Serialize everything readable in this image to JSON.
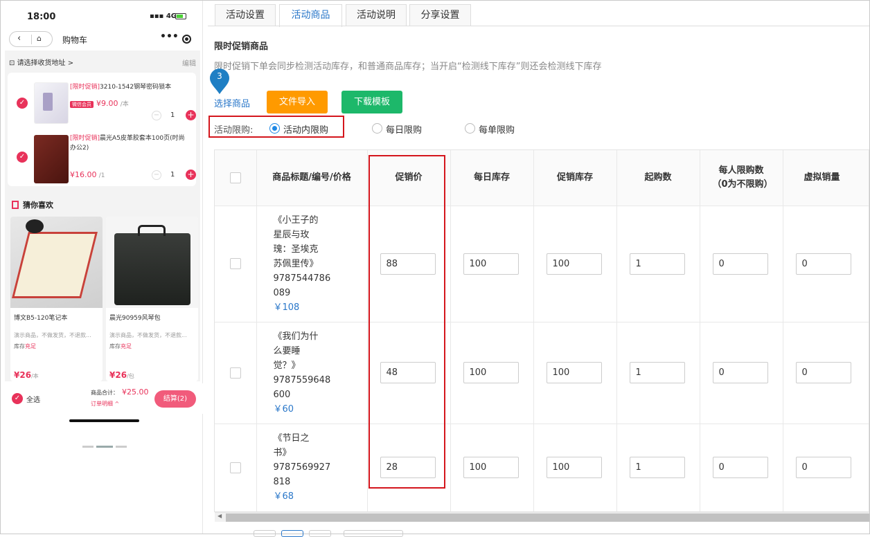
{
  "phone": {
    "time": "18:00",
    "signal": "4G",
    "nav_title": "购物车",
    "address": "请选择收货地址 >",
    "edit": "编辑",
    "cart_items": [
      {
        "tag": "[限时促销]",
        "name": "3210-1542钢琴密码锁本",
        "vip": "微信会员",
        "price": "¥9.00",
        "unit": "/本",
        "qty": "1"
      },
      {
        "tag": "[限时促销]",
        "name": "晨光A5皮革胶套本100页(时尚办公2)",
        "vip": "",
        "price": "¥16.00",
        "unit": "/1",
        "qty": "1"
      }
    ],
    "guess_title": "猜你喜欢",
    "guess_items": [
      {
        "name": "博文B5-120笔记本",
        "desc": "演示商品，不做发货，不退款...",
        "stock_label": "库存",
        "stock": "充足",
        "price": "¥26",
        "unit": "/本"
      },
      {
        "name": "晨光90959风琴包",
        "desc": "演示商品，不做发货，不退款...",
        "stock_label": "库存",
        "stock": "充足",
        "price": "¥26",
        "unit": "/包"
      }
    ],
    "select_all": "全选",
    "total_label": "商品合计：",
    "total_value": "¥25.00",
    "detail_link": "订单明细 ^",
    "checkout": "结算(2)"
  },
  "tabs": [
    "活动设置",
    "活动商品",
    "活动说明",
    "分享设置"
  ],
  "section_title": "限时促销商品",
  "section_desc": "限时促销下单会同步检测活动库存，和普通商品库存；当开启“检测线下库存”则还会检测线下库存",
  "step_badge": "3",
  "select_goods": "选择商品",
  "import_btn": "文件导入",
  "download_btn": "下载模板",
  "limit_label": "活动限购:",
  "limit_options": [
    "活动内限购",
    "每日限购",
    "每单限购"
  ],
  "table": {
    "headers": [
      "商品标题/编号/价格",
      "促销价",
      "每日库存",
      "促销库存",
      "起购数",
      "每人限购数（0为不限购）",
      "虚拟销量"
    ],
    "rows": [
      {
        "title_lines": [
          "《小王子的",
          "星辰与玫",
          "瑰：圣埃克",
          "苏佩里传》",
          "9787544786",
          "089"
        ],
        "price": "￥108",
        "promo": "88",
        "daily": "100",
        "stock": "100",
        "min": "1",
        "per": "0",
        "virtual": "0"
      },
      {
        "title_lines": [
          "《我们为什",
          "么要睡",
          "觉？》",
          "9787559648",
          "600"
        ],
        "price": "￥60",
        "promo": "48",
        "daily": "100",
        "stock": "100",
        "min": "1",
        "per": "0",
        "virtual": "0"
      },
      {
        "title_lines": [
          "《节日之",
          "书》",
          "9787569927",
          "818"
        ],
        "price": "￥68",
        "promo": "28",
        "daily": "100",
        "stock": "100",
        "min": "1",
        "per": "0",
        "virtual": "0"
      }
    ]
  },
  "colors": {
    "accent_blue": "#2a77c9",
    "orange": "#ff9a00",
    "green": "#1db86a",
    "highlight_red": "#d4151c",
    "shop_pink": "#e8325a"
  }
}
